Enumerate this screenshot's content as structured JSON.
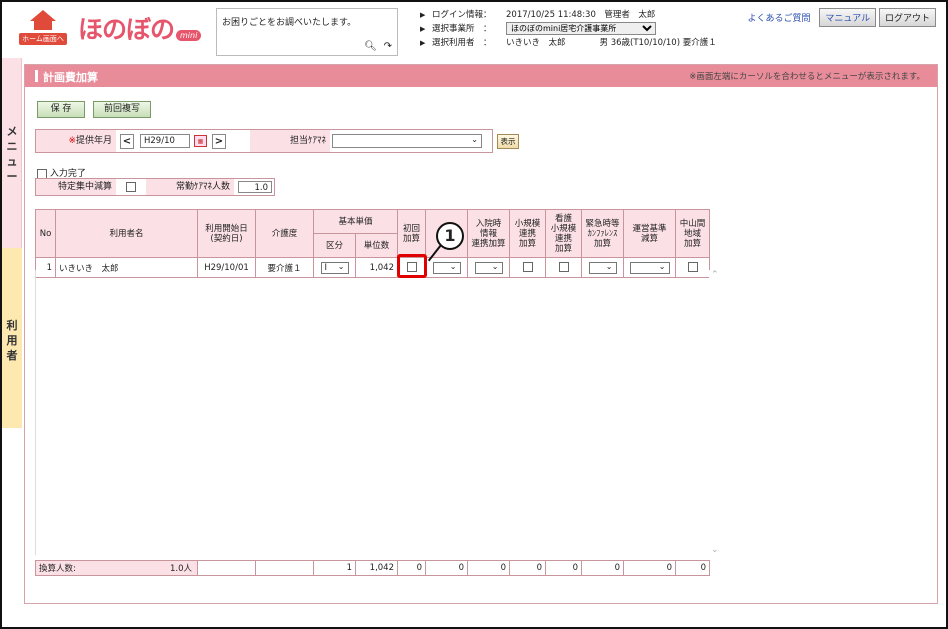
{
  "header": {
    "home_label": "ホーム画面へ",
    "logo_text": "ほのぼの",
    "logo_badge": "mini",
    "help_placeholder": "お困りごとをお調べいたします。",
    "login_label": "ログイン情報：",
    "login_value": "2017/10/25 11:48:30　管理者　太郎",
    "office_label": "選択事業所　：",
    "office_value": "ほのぼのmini居宅介護事業所",
    "user_label": "選択利用者　：",
    "user_value": "いきいき　太郎　　　　男 36歳(T10/10/10) 要介護１",
    "faq_link": "よくあるご質問",
    "manual_button": "マニュアル",
    "logout_button": "ログアウト"
  },
  "sidebar": {
    "menu_label": "メニュー",
    "user_label": "利用者"
  },
  "page": {
    "title": "計画費加算",
    "note": "※画面左端にカーソルを合わせるとメニューが表示されます。",
    "save_button": "保 存",
    "copy_button": "前回複写"
  },
  "filter": {
    "month_mark": "※",
    "month_label": "提供年月",
    "month_value": "H29/10",
    "prev": "<",
    "next": ">",
    "manager_label": "担当ｹｱﾏﾈ",
    "manager_value": "",
    "show_button": "表示"
  },
  "options": {
    "complete_label": "入力完了",
    "concentration_label": "特定集中減算",
    "fte_label": "常勤ｹｱﾏﾈ人数",
    "fte_value": "1.0"
  },
  "table": {
    "headers": {
      "no": "No",
      "name": "利用者名",
      "start": "利用開始日\n(契約日)",
      "care": "介護度",
      "base": "基本単価",
      "base_div": "区分",
      "base_units": "単位数",
      "first": "初回\n加算",
      "blank": "",
      "admit": "入院時\n情報\n連携加算",
      "small": "小規模\n連携\n加算",
      "nursing": "看護\n小規模\n連携\n加算",
      "emergency": "緊急時等\nｶﾝﾌｧﾚﾝｽ\n加算",
      "operation": "運営基準\n減算",
      "mountain": "中山間\n地域\n加算"
    },
    "rows": [
      {
        "no": "1",
        "name": "いきいき　太郎",
        "start": "H29/10/01",
        "care": "要介護１",
        "div": "Ⅰ",
        "units": "1,042"
      }
    ],
    "totals": {
      "label": "換算人数:",
      "people": "1.0人",
      "c1": "",
      "c2": "",
      "div": "1",
      "units": "1,042",
      "first": "0",
      "blank": "0",
      "admit": "0",
      "small": "0",
      "nursing": "0",
      "emergency": "0",
      "operation": "0",
      "mountain": "0"
    }
  },
  "annotation": {
    "callout_number": "1"
  }
}
